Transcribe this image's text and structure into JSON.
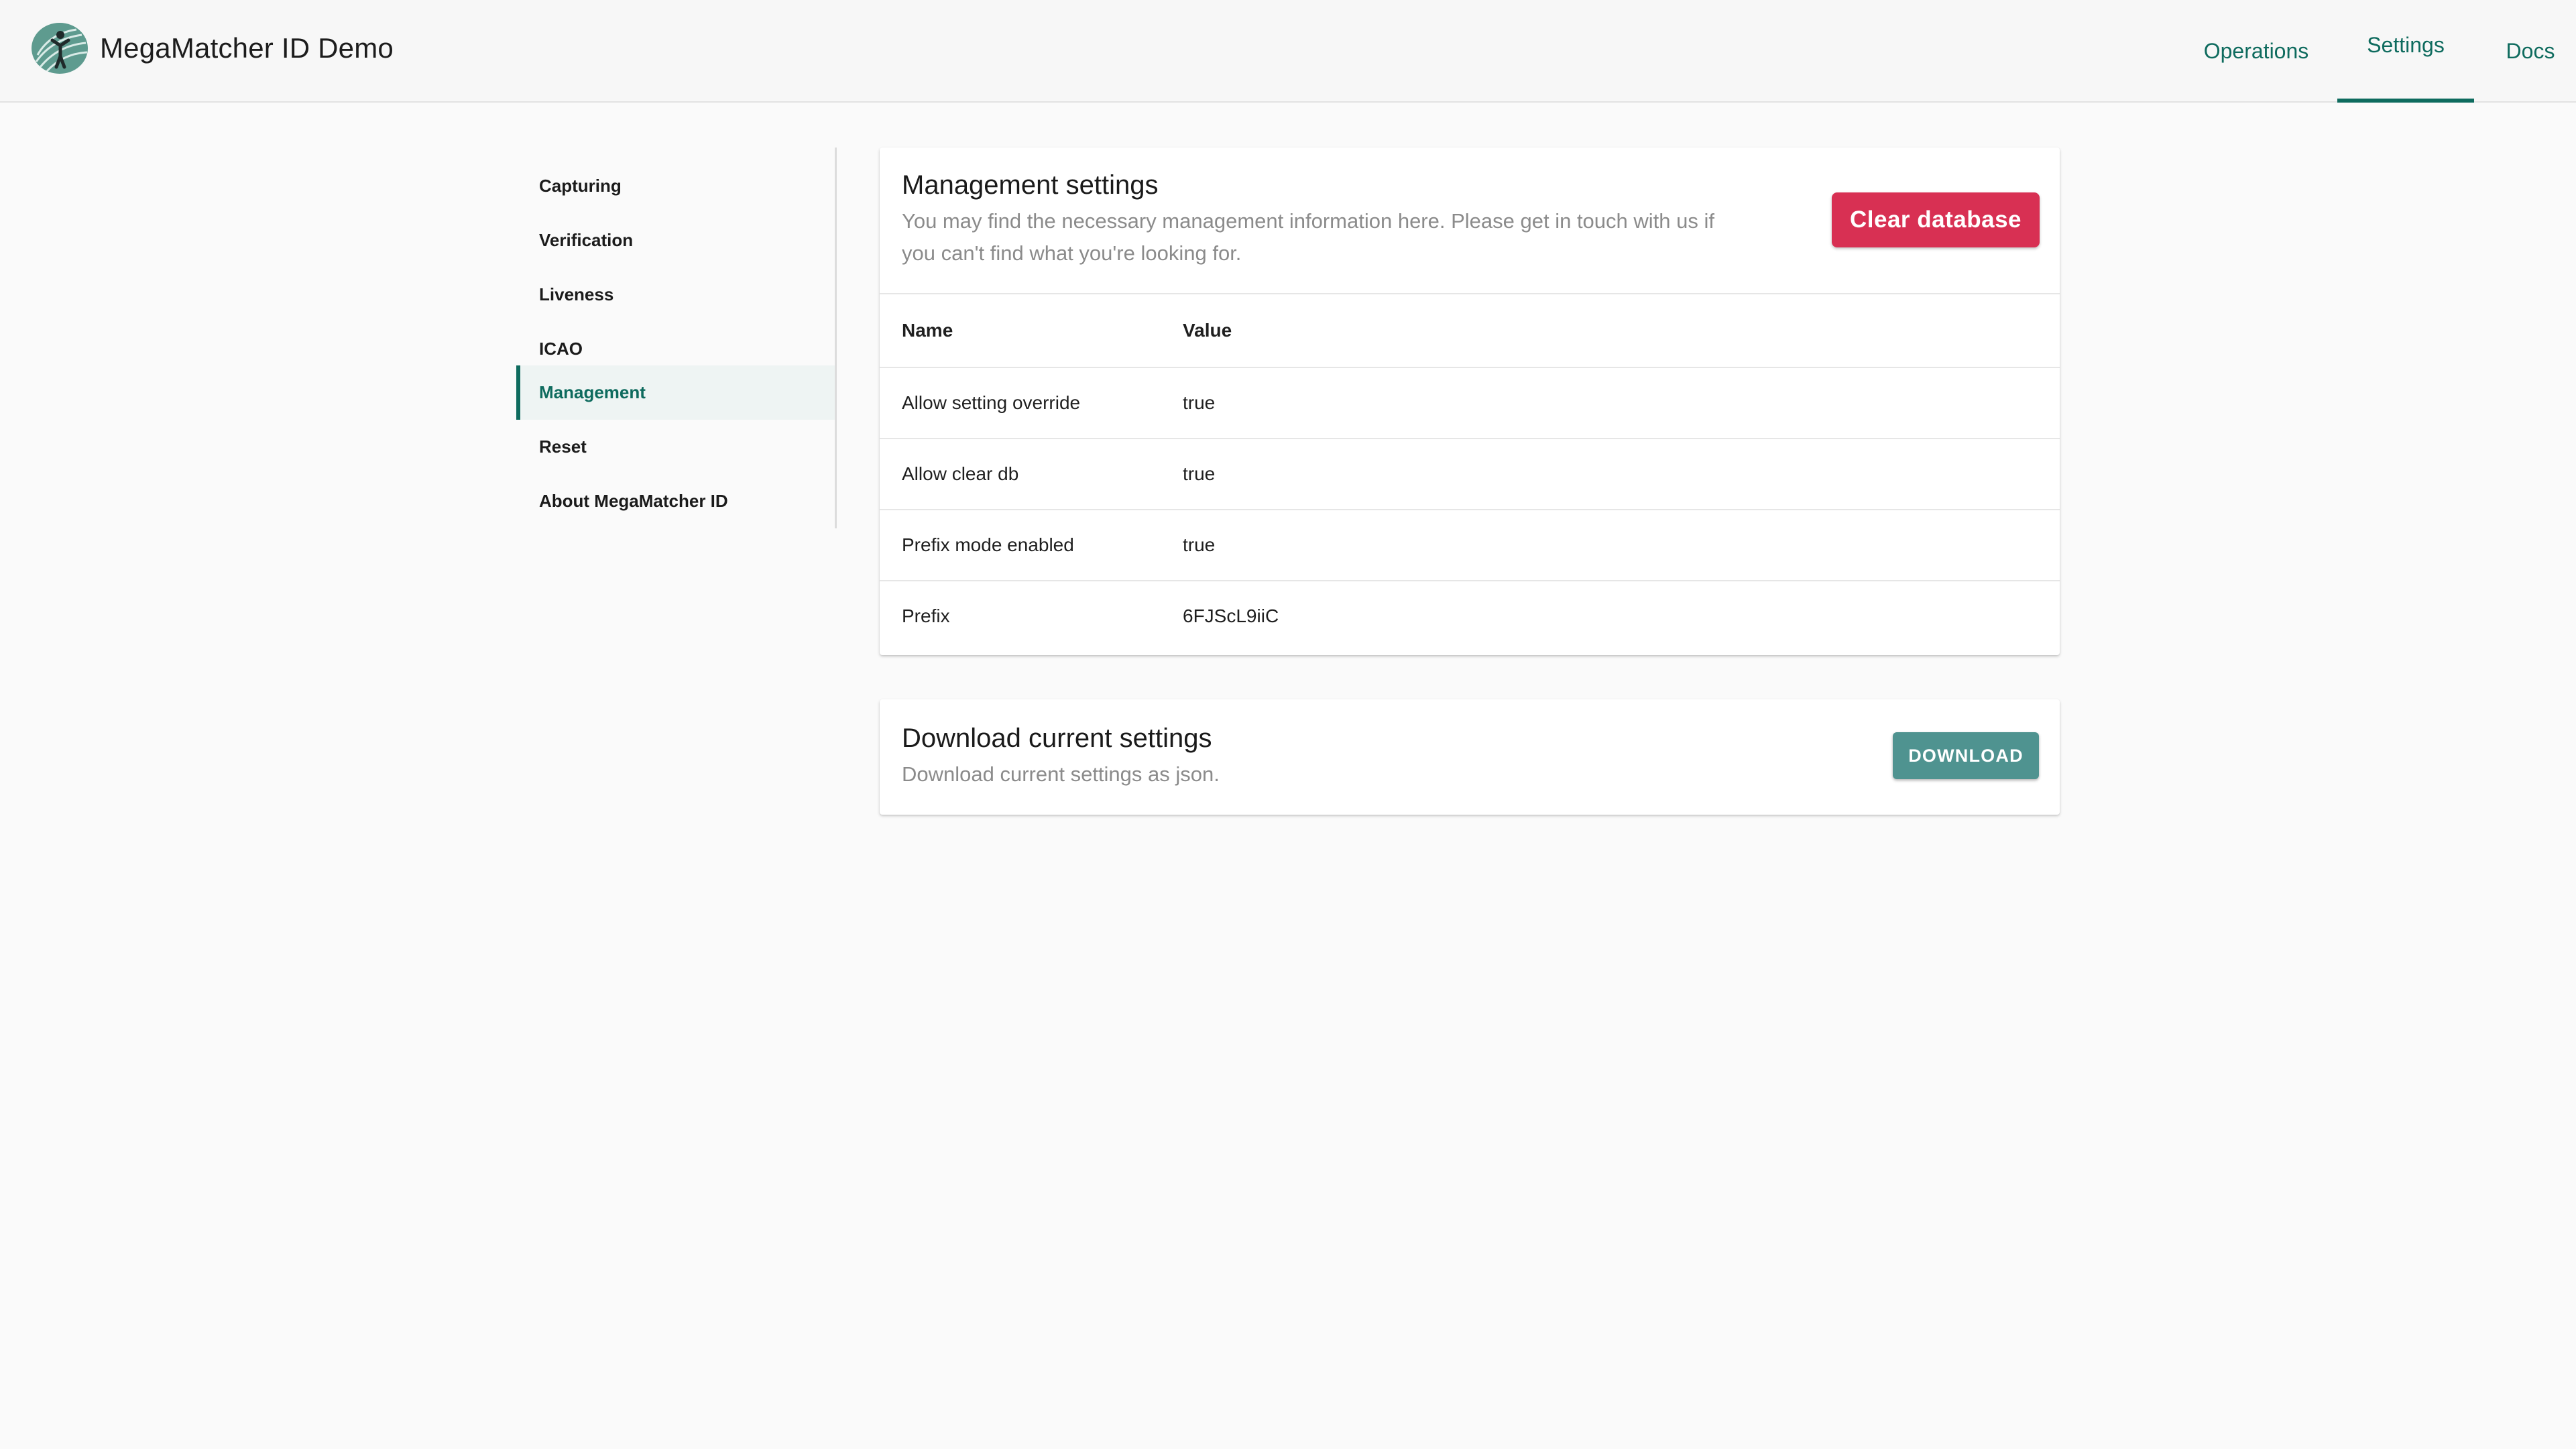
{
  "header": {
    "app_title": "MegaMatcher ID Demo",
    "logo_icon": "fingerprint-person-icon",
    "nav": [
      {
        "label": "Operations",
        "active": false
      },
      {
        "label": "Settings",
        "active": true
      },
      {
        "label": "Docs",
        "active": false
      }
    ]
  },
  "sidebar": {
    "items": [
      {
        "label": "Capturing",
        "active": false
      },
      {
        "label": "Verification",
        "active": false
      },
      {
        "label": "Liveness",
        "active": false
      },
      {
        "label": "ICAO",
        "active": false
      },
      {
        "label": "Management",
        "active": true
      },
      {
        "label": "Reset",
        "active": false
      },
      {
        "label": "About MegaMatcher ID",
        "active": false
      }
    ]
  },
  "management": {
    "title": "Management settings",
    "description": "You may find the necessary management information here. Please get in touch with us if you can't find what you're looking for.",
    "clear_button": "Clear database",
    "table": {
      "headers": [
        "Name",
        "Value"
      ],
      "rows": [
        {
          "name": "Allow setting override",
          "value": "true"
        },
        {
          "name": "Allow clear db",
          "value": "true"
        },
        {
          "name": "Prefix mode enabled",
          "value": "true"
        },
        {
          "name": "Prefix",
          "value": "6FJScL9iiC"
        }
      ]
    }
  },
  "download": {
    "title": "Download current settings",
    "description": "Download current settings as json.",
    "button": "DOWNLOAD"
  },
  "colors": {
    "accent": "#0e6b5e",
    "danger": "#d83053",
    "download_button": "#4f9390"
  }
}
